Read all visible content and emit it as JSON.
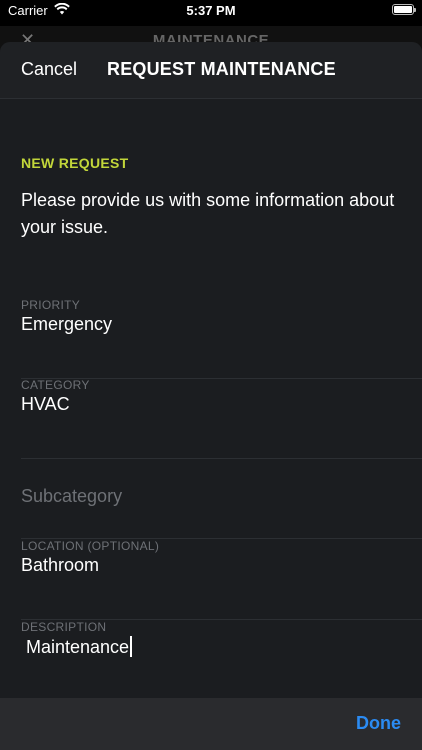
{
  "status_bar": {
    "carrier": "Carrier",
    "time": "5:37 PM"
  },
  "background_screen": {
    "close_glyph": "✕",
    "title": "MAINTENANCE"
  },
  "nav": {
    "cancel_label": "Cancel",
    "title": "REQUEST MAINTENANCE"
  },
  "form": {
    "section_label": "NEW REQUEST",
    "intro_text": "Please provide us with some information about your issue.",
    "priority": {
      "label": "PRIORITY",
      "value": "Emergency"
    },
    "category": {
      "label": "CATEGORY",
      "value": "HVAC"
    },
    "subcategory": {
      "placeholder": "Subcategory"
    },
    "location": {
      "label": "LOCATION (OPTIONAL)",
      "value": "Bathroom"
    },
    "description": {
      "label": "DESCRIPTION",
      "value": "Maintenance"
    }
  },
  "accessory": {
    "done_label": "Done"
  },
  "colors": {
    "accent_green": "#c2d63a",
    "link_blue": "#2b8bf2",
    "sheet_background": "#1b1d20"
  }
}
